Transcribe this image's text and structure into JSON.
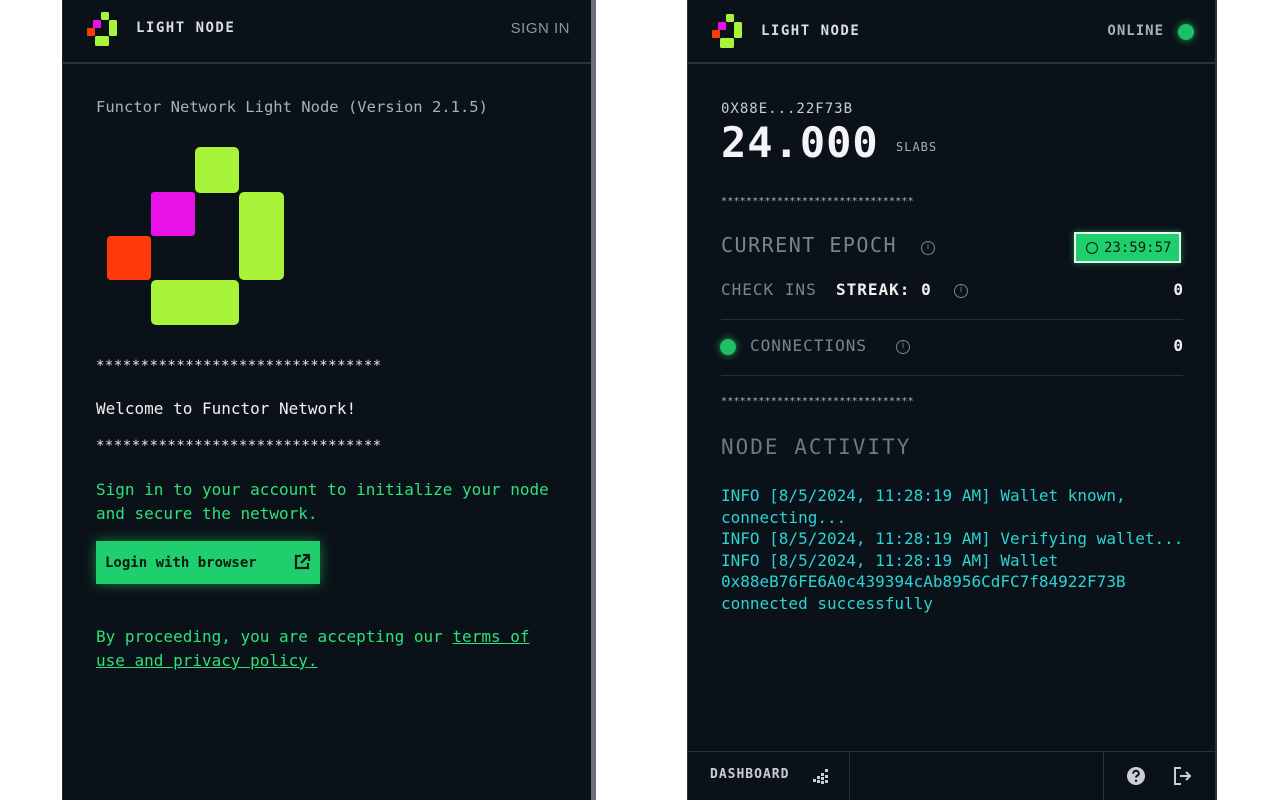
{
  "colors": {
    "panel_bg": "#0b1118",
    "accent_green": "#1fcf6e",
    "text_green": "#2ee07a",
    "log_cyan": "#2ad4d4",
    "logo_lime": "#a8f43a",
    "logo_magenta": "#e812e8",
    "logo_red": "#ff3a0a"
  },
  "left": {
    "header": {
      "brand": "LIGHT NODE",
      "sign_in": "SIGN IN"
    },
    "version": "Functor Network Light Node (Version 2.1.5)",
    "stars_top": "********************************",
    "welcome": "Welcome to Functor Network!",
    "stars_bottom": "********************************",
    "signin_text": "Sign in to your account to initialize your node and secure the network.",
    "login_button": "Login with browser",
    "login_button_icon": "external-link-icon",
    "proceed_prefix": "By proceeding, you are accepting our ",
    "proceed_link": "terms of use and privacy policy."
  },
  "right": {
    "header": {
      "brand": "LIGHT NODE",
      "status": "ONLINE"
    },
    "wallet_short": "0X88E...22F73B",
    "balance": "24.000",
    "balance_unit": "SLABS",
    "stars_1": "*******************************",
    "epoch_label": "CURRENT EPOCH",
    "epoch_timer": "23:59:57",
    "checkins_label": "CHECK INS",
    "streak_label": "STREAK:",
    "streak_value": "0",
    "checkins_value": "0",
    "connections_label": "CONNECTIONS",
    "connections_value": "0",
    "stars_2": "*******************************",
    "activity_title": "NODE ACTIVITY",
    "log": [
      "INFO [8/5/2024, 11:28:19 AM] Wallet known, connecting...",
      "INFO [8/5/2024, 11:28:19 AM] Verifying wallet...",
      "INFO [8/5/2024, 11:28:19 AM] Wallet 0x88eB76FE6A0c439394cAb8956CdFC7f84922F73B connected successfully"
    ],
    "footer": {
      "dashboard": "DASHBOARD",
      "dashboard_icon": "bar-chart-icon",
      "help_icon": "help-icon",
      "logout_icon": "logout-icon"
    }
  }
}
